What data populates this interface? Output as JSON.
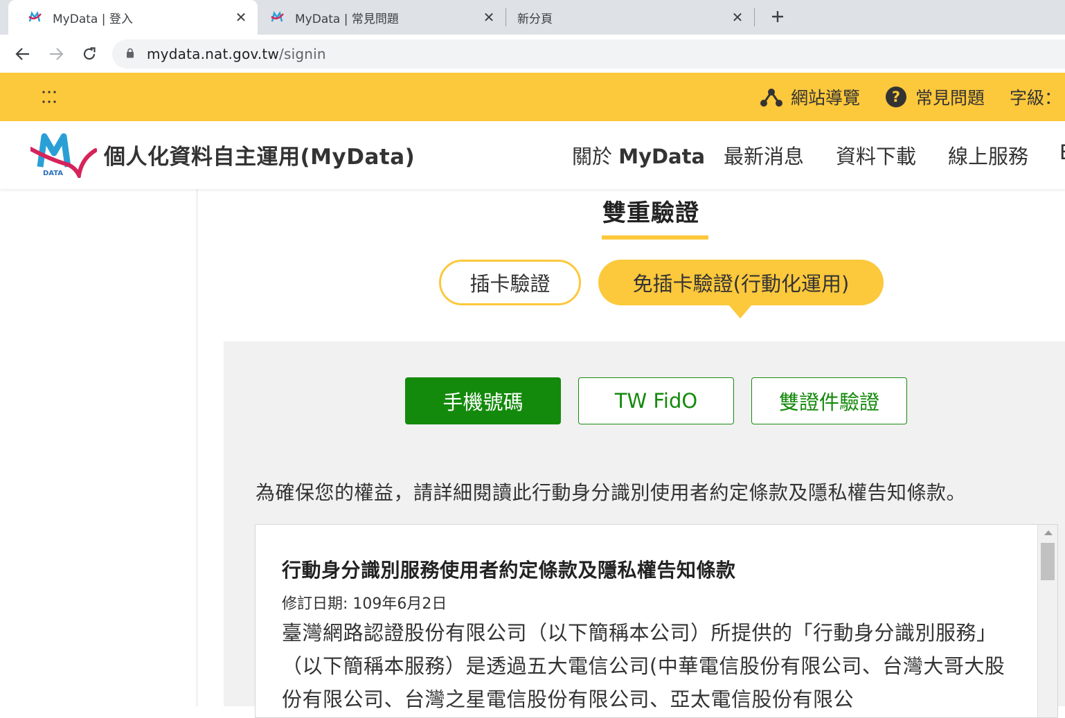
{
  "browser": {
    "tabs": [
      {
        "title": "MyData | 登入",
        "active": true
      },
      {
        "title": "MyData | 常見問題",
        "active": false
      },
      {
        "title": "新分頁",
        "active": false
      }
    ],
    "url_host": "mydata.nat.gov.tw",
    "url_path": "/signin"
  },
  "utility": {
    "sitemap_label": "網站導覽",
    "faq_label": "常見問題",
    "fontsize_label": "字級："
  },
  "header": {
    "site_name": "個人化資料自主運用(MyData)",
    "logo_text": "DATA",
    "nav": [
      {
        "prefix": "關於 ",
        "bold": "MyData"
      },
      {
        "label": "最新消息"
      },
      {
        "label": "資料下載"
      },
      {
        "label": "線上服務"
      },
      {
        "label": "E"
      }
    ]
  },
  "main": {
    "section_title": "雙重驗證",
    "auth_tabs": [
      {
        "label": "插卡驗證",
        "selected": false
      },
      {
        "label": "免插卡驗證(行動化運用)",
        "selected": true
      }
    ],
    "methods": [
      {
        "label": "手機號碼",
        "selected": true
      },
      {
        "label": "TW FidO",
        "selected": false
      },
      {
        "label": "雙證件驗證",
        "selected": false
      }
    ],
    "notice": "為確保您的權益，請詳細閱讀此行動身分識別使用者約定條款及隱私權告知條款。",
    "terms": {
      "title": "行動身分識別服務使用者約定條款及隱私權告知條款",
      "date": "修訂日期: 109年6月2日",
      "body": "臺灣網路認證股份有限公司（以下簡稱本公司）所提供的「行動身分識別服務」（以下簡稱本服務）是透過五大電信公司(中華電信股份有限公司、台灣大哥大股份有限公司、台灣之星電信股份有限公司、亞太電信股份有限公"
    }
  },
  "colors": {
    "brand_yellow": "#fcc83c",
    "brand_green": "#148a0c",
    "panel_gray": "#f1f1f1"
  }
}
